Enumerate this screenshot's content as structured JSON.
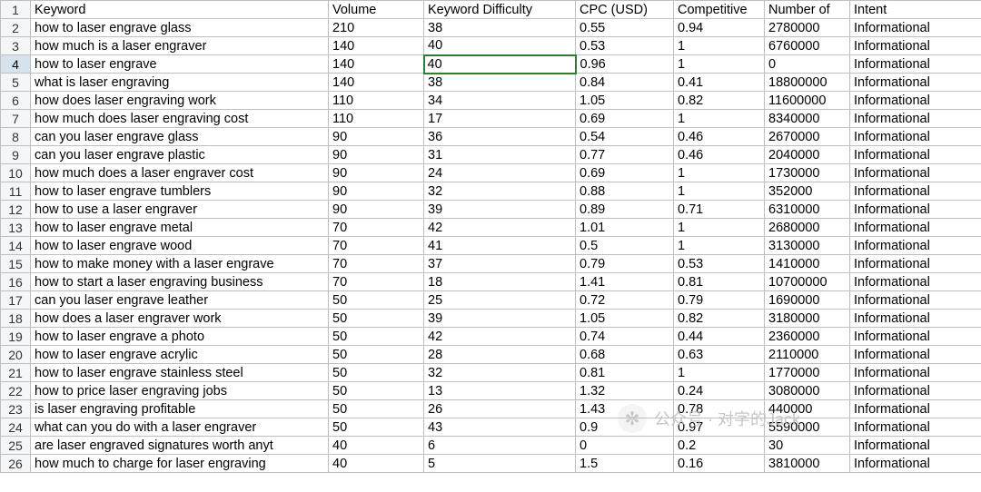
{
  "sheet": {
    "headers": {
      "a": "Keyword",
      "b": "Volume",
      "c": "Keyword Difficulty",
      "d": "CPC (USD)",
      "e": "Competitive",
      "f": "Number of",
      "g": "Intent"
    },
    "active_cell": {
      "row": 4,
      "col": "c"
    },
    "rows": [
      {
        "n": 2,
        "a": "how to laser engrave glass",
        "b": "210",
        "c": "38",
        "d": "0.55",
        "e": "0.94",
        "f": "2780000",
        "g": "Informational"
      },
      {
        "n": 3,
        "a": "how much is a laser engraver",
        "b": "140",
        "c": "40",
        "d": "0.53",
        "e": "1",
        "f": "6760000",
        "g": "Informational"
      },
      {
        "n": 4,
        "a": "how to laser engrave",
        "b": "140",
        "c": "40",
        "d": "0.96",
        "e": "1",
        "f": "0",
        "g": "Informational"
      },
      {
        "n": 5,
        "a": "what is laser engraving",
        "b": "140",
        "c": "38",
        "d": "0.84",
        "e": "0.41",
        "f": "18800000",
        "g": "Informational"
      },
      {
        "n": 6,
        "a": "how does laser engraving work",
        "b": "110",
        "c": "34",
        "d": "1.05",
        "e": "0.82",
        "f": "11600000",
        "g": "Informational"
      },
      {
        "n": 7,
        "a": "how much does laser engraving cost",
        "b": "110",
        "c": "17",
        "d": "0.69",
        "e": "1",
        "f": "8340000",
        "g": "Informational"
      },
      {
        "n": 8,
        "a": "can you laser engrave glass",
        "b": "90",
        "c": "36",
        "d": "0.54",
        "e": "0.46",
        "f": "2670000",
        "g": "Informational"
      },
      {
        "n": 9,
        "a": "can you laser engrave plastic",
        "b": "90",
        "c": "31",
        "d": "0.77",
        "e": "0.46",
        "f": "2040000",
        "g": "Informational"
      },
      {
        "n": 10,
        "a": "how much does a laser engraver cost",
        "b": "90",
        "c": "24",
        "d": "0.69",
        "e": "1",
        "f": "1730000",
        "g": "Informational"
      },
      {
        "n": 11,
        "a": "how to laser engrave tumblers",
        "b": "90",
        "c": "32",
        "d": "0.88",
        "e": "1",
        "f": "352000",
        "g": "Informational"
      },
      {
        "n": 12,
        "a": "how to use a laser engraver",
        "b": "90",
        "c": "39",
        "d": "0.89",
        "e": "0.71",
        "f": "6310000",
        "g": "Informational"
      },
      {
        "n": 13,
        "a": "how to laser engrave metal",
        "b": "70",
        "c": "42",
        "d": "1.01",
        "e": "1",
        "f": "2680000",
        "g": "Informational"
      },
      {
        "n": 14,
        "a": "how to laser engrave wood",
        "b": "70",
        "c": "41",
        "d": "0.5",
        "e": "1",
        "f": "3130000",
        "g": "Informational"
      },
      {
        "n": 15,
        "a": "how to make money with a laser engrave",
        "b": "70",
        "c": "37",
        "d": "0.79",
        "e": "0.53",
        "f": "1410000",
        "g": "Informational"
      },
      {
        "n": 16,
        "a": "how to start a laser engraving business",
        "b": "70",
        "c": "18",
        "d": "1.41",
        "e": "0.81",
        "f": "10700000",
        "g": "Informational"
      },
      {
        "n": 17,
        "a": "can you laser engrave leather",
        "b": "50",
        "c": "25",
        "d": "0.72",
        "e": "0.79",
        "f": "1690000",
        "g": "Informational"
      },
      {
        "n": 18,
        "a": "how does a laser engraver work",
        "b": "50",
        "c": "39",
        "d": "1.05",
        "e": "0.82",
        "f": "3180000",
        "g": "Informational"
      },
      {
        "n": 19,
        "a": "how to laser engrave a photo",
        "b": "50",
        "c": "42",
        "d": "0.74",
        "e": "0.44",
        "f": "2360000",
        "g": "Informational"
      },
      {
        "n": 20,
        "a": "how to laser engrave acrylic",
        "b": "50",
        "c": "28",
        "d": "0.68",
        "e": "0.63",
        "f": "2110000",
        "g": "Informational"
      },
      {
        "n": 21,
        "a": "how to laser engrave stainless steel",
        "b": "50",
        "c": "32",
        "d": "0.81",
        "e": "1",
        "f": "1770000",
        "g": "Informational"
      },
      {
        "n": 22,
        "a": "how to price laser engraving jobs",
        "b": "50",
        "c": "13",
        "d": "1.32",
        "e": "0.24",
        "f": "3080000",
        "g": "Informational"
      },
      {
        "n": 23,
        "a": "is laser engraving profitable",
        "b": "50",
        "c": "26",
        "d": "1.43",
        "e": "0.78",
        "f": "440000",
        "g": "Informational"
      },
      {
        "n": 24,
        "a": "what can you do with a laser engraver",
        "b": "50",
        "c": "43",
        "d": "0.9",
        "e": "0.97",
        "f": "5590000",
        "g": "Informational"
      },
      {
        "n": 25,
        "a": "are laser engraved signatures worth anyt",
        "b": "40",
        "c": "6",
        "d": "0",
        "e": "0.2",
        "f": "30",
        "g": "Informational"
      },
      {
        "n": 26,
        "a": "how much to charge for laser engraving",
        "b": "40",
        "c": "5",
        "d": "1.5",
        "e": "0.16",
        "f": "3810000",
        "g": "Informational"
      }
    ]
  },
  "watermark": {
    "text": "公众号 · 对字的Jack"
  }
}
